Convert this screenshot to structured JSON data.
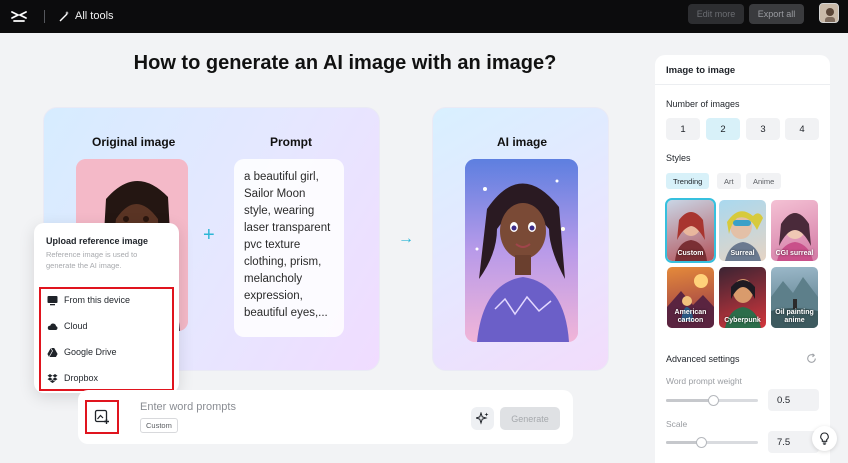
{
  "topbar": {
    "all_tools_label": "All tools",
    "edit_more_label": "Edit more",
    "export_all_label": "Export all"
  },
  "headline": "How to generate an AI image with an image?",
  "example": {
    "original_title": "Original image",
    "prompt_title": "Prompt",
    "prompt_text": "a beautiful girl, Sailor Moon style, wearing laser transparent pvc texture clothing, prism, melancholy expression, beautiful eyes,...",
    "ai_title": "AI image",
    "plus_symbol": "+",
    "arrow_symbol": "→"
  },
  "upload_popover": {
    "title": "Upload reference image",
    "description": "Reference image is used to generate the AI image.",
    "options": [
      {
        "label": "From this device",
        "icon": "monitor-icon"
      },
      {
        "label": "Cloud",
        "icon": "cloud-icon"
      },
      {
        "label": "Google Drive",
        "icon": "google-drive-icon"
      },
      {
        "label": "Dropbox",
        "icon": "dropbox-icon"
      }
    ]
  },
  "prompt_bar": {
    "placeholder": "Enter word prompts",
    "tag": "Custom",
    "generate_label": "Generate"
  },
  "side_panel": {
    "title": "Image to image",
    "number_label": "Number of images",
    "numbers": [
      "1",
      "2",
      "3",
      "4"
    ],
    "selected_number": "2",
    "styles_label": "Styles",
    "style_tabs": [
      "Trending",
      "Art",
      "Anime"
    ],
    "active_tab": "Trending",
    "styles": [
      {
        "label": "Custom"
      },
      {
        "label": "Surreal"
      },
      {
        "label": "CGI surreal"
      },
      {
        "label": "American cartoon"
      },
      {
        "label": "Cyberpunk"
      },
      {
        "label": "Oil painting anime"
      }
    ],
    "advanced_label": "Advanced settings",
    "weight_label": "Word prompt weight",
    "weight_value": "0.5",
    "scale_label": "Scale",
    "scale_value": "7.5"
  },
  "colors": {
    "accent": "#2cb6d6",
    "highlight_red": "#e0141e",
    "topbar_bg": "#0c0c0d"
  }
}
